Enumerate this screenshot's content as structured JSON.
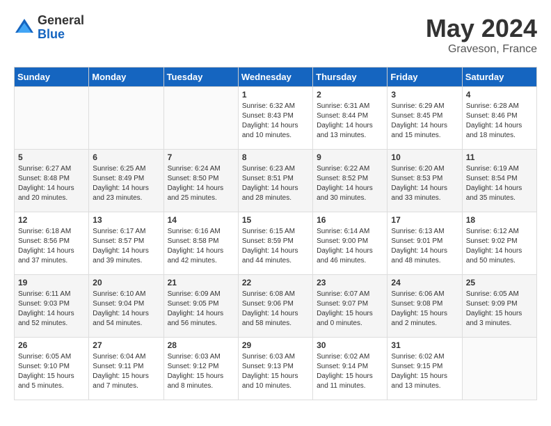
{
  "logo": {
    "general": "General",
    "blue": "Blue"
  },
  "title": "May 2024",
  "location": "Graveson, France",
  "days_of_week": [
    "Sunday",
    "Monday",
    "Tuesday",
    "Wednesday",
    "Thursday",
    "Friday",
    "Saturday"
  ],
  "weeks": [
    {
      "days": [
        {
          "number": "",
          "content": ""
        },
        {
          "number": "",
          "content": ""
        },
        {
          "number": "",
          "content": ""
        },
        {
          "number": "1",
          "content": "Sunrise: 6:32 AM\nSunset: 8:43 PM\nDaylight: 14 hours\nand 10 minutes."
        },
        {
          "number": "2",
          "content": "Sunrise: 6:31 AM\nSunset: 8:44 PM\nDaylight: 14 hours\nand 13 minutes."
        },
        {
          "number": "3",
          "content": "Sunrise: 6:29 AM\nSunset: 8:45 PM\nDaylight: 14 hours\nand 15 minutes."
        },
        {
          "number": "4",
          "content": "Sunrise: 6:28 AM\nSunset: 8:46 PM\nDaylight: 14 hours\nand 18 minutes."
        }
      ]
    },
    {
      "days": [
        {
          "number": "5",
          "content": "Sunrise: 6:27 AM\nSunset: 8:48 PM\nDaylight: 14 hours\nand 20 minutes."
        },
        {
          "number": "6",
          "content": "Sunrise: 6:25 AM\nSunset: 8:49 PM\nDaylight: 14 hours\nand 23 minutes."
        },
        {
          "number": "7",
          "content": "Sunrise: 6:24 AM\nSunset: 8:50 PM\nDaylight: 14 hours\nand 25 minutes."
        },
        {
          "number": "8",
          "content": "Sunrise: 6:23 AM\nSunset: 8:51 PM\nDaylight: 14 hours\nand 28 minutes."
        },
        {
          "number": "9",
          "content": "Sunrise: 6:22 AM\nSunset: 8:52 PM\nDaylight: 14 hours\nand 30 minutes."
        },
        {
          "number": "10",
          "content": "Sunrise: 6:20 AM\nSunset: 8:53 PM\nDaylight: 14 hours\nand 33 minutes."
        },
        {
          "number": "11",
          "content": "Sunrise: 6:19 AM\nSunset: 8:54 PM\nDaylight: 14 hours\nand 35 minutes."
        }
      ]
    },
    {
      "days": [
        {
          "number": "12",
          "content": "Sunrise: 6:18 AM\nSunset: 8:56 PM\nDaylight: 14 hours\nand 37 minutes."
        },
        {
          "number": "13",
          "content": "Sunrise: 6:17 AM\nSunset: 8:57 PM\nDaylight: 14 hours\nand 39 minutes."
        },
        {
          "number": "14",
          "content": "Sunrise: 6:16 AM\nSunset: 8:58 PM\nDaylight: 14 hours\nand 42 minutes."
        },
        {
          "number": "15",
          "content": "Sunrise: 6:15 AM\nSunset: 8:59 PM\nDaylight: 14 hours\nand 44 minutes."
        },
        {
          "number": "16",
          "content": "Sunrise: 6:14 AM\nSunset: 9:00 PM\nDaylight: 14 hours\nand 46 minutes."
        },
        {
          "number": "17",
          "content": "Sunrise: 6:13 AM\nSunset: 9:01 PM\nDaylight: 14 hours\nand 48 minutes."
        },
        {
          "number": "18",
          "content": "Sunrise: 6:12 AM\nSunset: 9:02 PM\nDaylight: 14 hours\nand 50 minutes."
        }
      ]
    },
    {
      "days": [
        {
          "number": "19",
          "content": "Sunrise: 6:11 AM\nSunset: 9:03 PM\nDaylight: 14 hours\nand 52 minutes."
        },
        {
          "number": "20",
          "content": "Sunrise: 6:10 AM\nSunset: 9:04 PM\nDaylight: 14 hours\nand 54 minutes."
        },
        {
          "number": "21",
          "content": "Sunrise: 6:09 AM\nSunset: 9:05 PM\nDaylight: 14 hours\nand 56 minutes."
        },
        {
          "number": "22",
          "content": "Sunrise: 6:08 AM\nSunset: 9:06 PM\nDaylight: 14 hours\nand 58 minutes."
        },
        {
          "number": "23",
          "content": "Sunrise: 6:07 AM\nSunset: 9:07 PM\nDaylight: 15 hours\nand 0 minutes."
        },
        {
          "number": "24",
          "content": "Sunrise: 6:06 AM\nSunset: 9:08 PM\nDaylight: 15 hours\nand 2 minutes."
        },
        {
          "number": "25",
          "content": "Sunrise: 6:05 AM\nSunset: 9:09 PM\nDaylight: 15 hours\nand 3 minutes."
        }
      ]
    },
    {
      "days": [
        {
          "number": "26",
          "content": "Sunrise: 6:05 AM\nSunset: 9:10 PM\nDaylight: 15 hours\nand 5 minutes."
        },
        {
          "number": "27",
          "content": "Sunrise: 6:04 AM\nSunset: 9:11 PM\nDaylight: 15 hours\nand 7 minutes."
        },
        {
          "number": "28",
          "content": "Sunrise: 6:03 AM\nSunset: 9:12 PM\nDaylight: 15 hours\nand 8 minutes."
        },
        {
          "number": "29",
          "content": "Sunrise: 6:03 AM\nSunset: 9:13 PM\nDaylight: 15 hours\nand 10 minutes."
        },
        {
          "number": "30",
          "content": "Sunrise: 6:02 AM\nSunset: 9:14 PM\nDaylight: 15 hours\nand 11 minutes."
        },
        {
          "number": "31",
          "content": "Sunrise: 6:02 AM\nSunset: 9:15 PM\nDaylight: 15 hours\nand 13 minutes."
        },
        {
          "number": "",
          "content": ""
        }
      ]
    }
  ]
}
